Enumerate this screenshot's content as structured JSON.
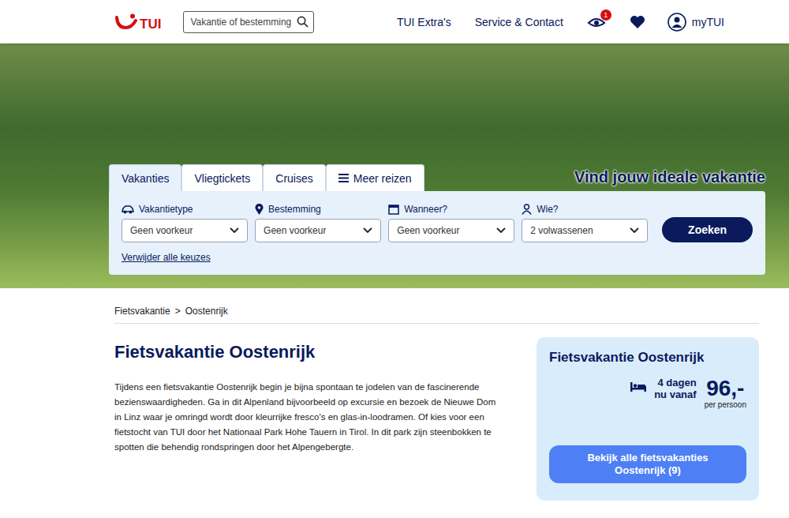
{
  "header": {
    "logo": "TUI",
    "search": {
      "placeholder": "Vakantie of bestemming"
    },
    "nav": [
      "TUI Extra's",
      "Service & Contact"
    ],
    "viewed_badge": "1",
    "account": "myTUI"
  },
  "hero": {
    "title": "Vind jouw ideale vakantie"
  },
  "search_widget": {
    "tabs": [
      {
        "label": "Vakanties",
        "selected": true
      },
      {
        "label": "Vliegtickets",
        "selected": false
      },
      {
        "label": "Cruises",
        "selected": false
      },
      {
        "label": "Meer reizen",
        "selected": false
      }
    ],
    "fields": [
      {
        "label": "Vakantietype",
        "value": "Geen voorkeur"
      },
      {
        "label": "Bestemming",
        "value": "Geen voorkeur"
      },
      {
        "label": "Wanneer?",
        "value": "Geen voorkeur"
      },
      {
        "label": "Wie?",
        "value": "2 volwassenen"
      }
    ],
    "button": "Zoeken",
    "reset": "Verwijder alle keuzes"
  },
  "breadcrumb": {
    "items": [
      "Fietsvakantie",
      "Oostenrijk"
    ],
    "separator": ">"
  },
  "article": {
    "title": "Fietsvakantie Oostenrijk",
    "body": "Tijdens een fietsvakantie Oostenrijk begin je bijna spontaan te jodelen van de fascinerende bezienswaardigheden. Ga in dit Alpenland bijvoorbeeld op excursie en bezoek de Nieuwe Dom in Linz waar  je omringd wordt door kleurrijke fresco's en glas-in-loodramen. Of kies voor een fietstocht van TUI door het Nationaal Park Hohe Tauern in Tirol. In dit park zijn steenbokken te spotten die behendig rondspringen door het Alpengebergte."
  },
  "card": {
    "title": "Fietsvakantie Oostenrijk",
    "duration": "4 dagen",
    "note": "nu vanaf",
    "price": "96,-",
    "unit": "per persoon",
    "button": "Bekijk alle fietsvakanties Oostenrijk (9)"
  }
}
